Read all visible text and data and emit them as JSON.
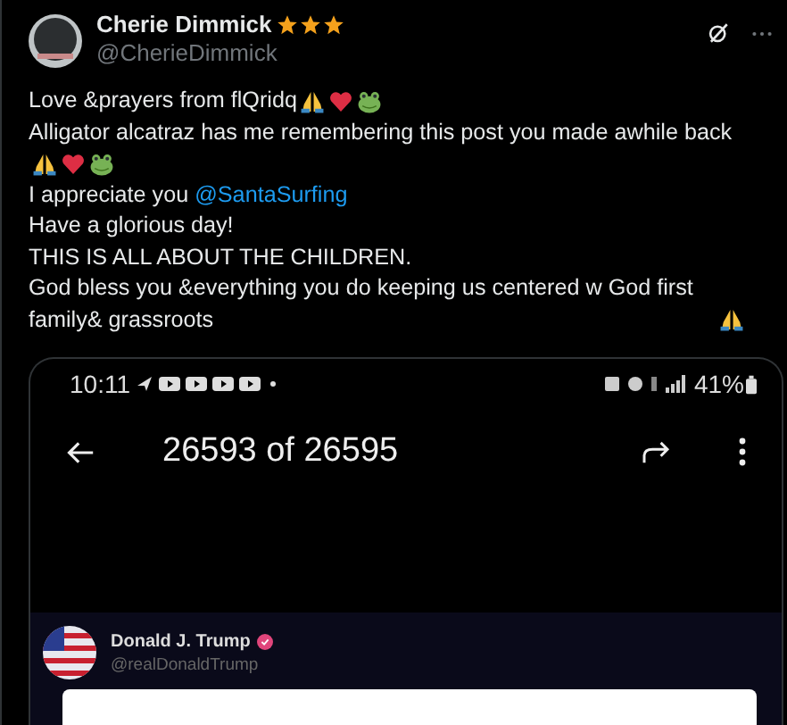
{
  "author": {
    "name": "Cherie Dimmick",
    "badges": [
      {
        "kind": "star"
      },
      {
        "kind": "star"
      },
      {
        "kind": "star"
      }
    ],
    "handle": "@CherieDimmick"
  },
  "lines": [
    {
      "text": "Love &prayers from flQridq",
      "emojis": [
        {
          "kind": "pray"
        },
        {
          "kind": "heart"
        },
        {
          "kind": "frog"
        }
      ]
    },
    {
      "text": "Alligator alcatraz has me remembering this post you made awhile back"
    },
    {
      "emojis": [
        {
          "kind": "pray"
        },
        {
          "kind": "heart"
        },
        {
          "kind": "frog"
        }
      ]
    },
    {
      "text": "I appreciate you ",
      "mention": "@SantaSurfing"
    },
    {
      "text": "Have a glorious day!"
    },
    {
      "text": "THIS IS ALL ABOUT THE CHILDREN."
    },
    {
      "text": "God bless you &everything you do keeping us centered w God first family& grassroots",
      "emojis": [
        {
          "kind": "pray"
        }
      ]
    }
  ],
  "embed": {
    "time": "10:11",
    "battery": "41%",
    "counter": "26593 of 26595",
    "post": {
      "name": "Donald J. Trump",
      "handle": "@realDonaldTrump"
    }
  }
}
